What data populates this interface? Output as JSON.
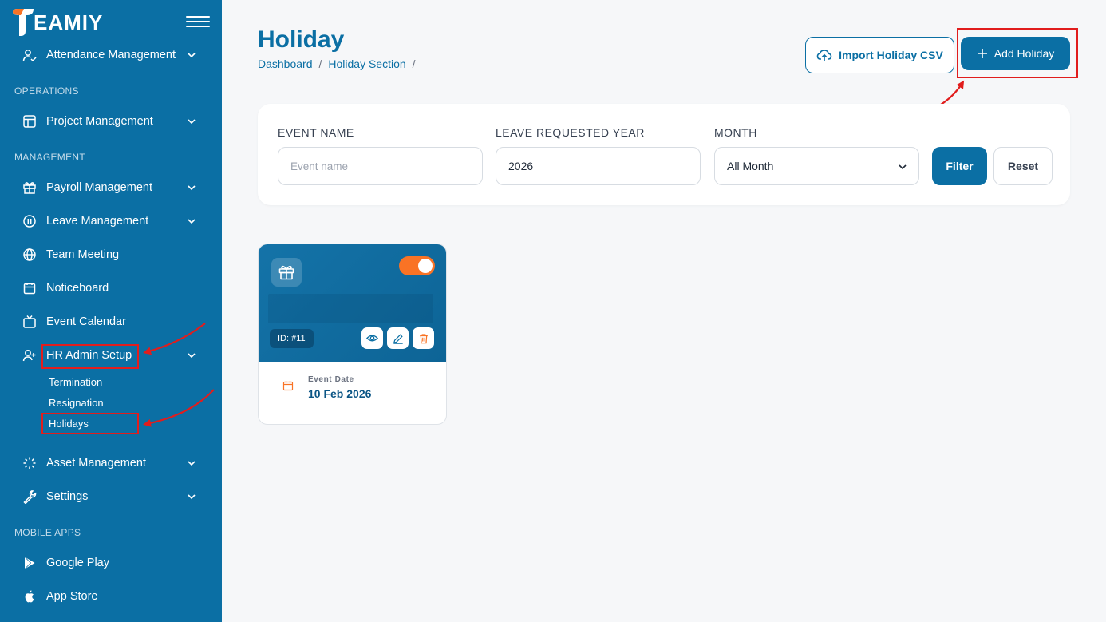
{
  "brand": {
    "logo_text": "EAMIY",
    "accent": "#0b6fa4",
    "orange": "#f97325"
  },
  "sidebar": {
    "top_item": {
      "label": "Attendance Management",
      "icon": "user-check-icon"
    },
    "sections": {
      "operations": "OPERATIONS",
      "management": "MANAGEMENT",
      "mobile_apps": "MOBILE APPS"
    },
    "items": {
      "project": "Project Management",
      "payroll": "Payroll Management",
      "leave": "Leave Management",
      "meeting": "Team Meeting",
      "noticeboard": "Noticeboard",
      "calendar": "Event Calendar",
      "hr_admin": "HR Admin Setup",
      "asset": "Asset Management",
      "settings": "Settings",
      "google_play": "Google Play",
      "app_store": "App Store"
    },
    "hr_sub": {
      "termination": "Termination",
      "resignation": "Resignation",
      "holidays": "Holidays"
    }
  },
  "header": {
    "title": "Holiday",
    "breadcrumb": [
      "Dashboard",
      "Holiday Section"
    ],
    "sep": "/",
    "import_label": "Import Holiday CSV",
    "add_label": "Add Holiday"
  },
  "filter": {
    "event_name_label": "EVENT NAME",
    "event_name_placeholder": "Event name",
    "year_label": "LEAVE REQUESTED YEAR",
    "year_value": "2026",
    "month_label": "MONTH",
    "month_value": "All Month",
    "filter_label": "Filter",
    "reset_label": "Reset"
  },
  "holiday": {
    "id": "ID: #11",
    "enabled": true,
    "event_date_label": "Event Date",
    "event_date": "10 Feb 2026"
  }
}
